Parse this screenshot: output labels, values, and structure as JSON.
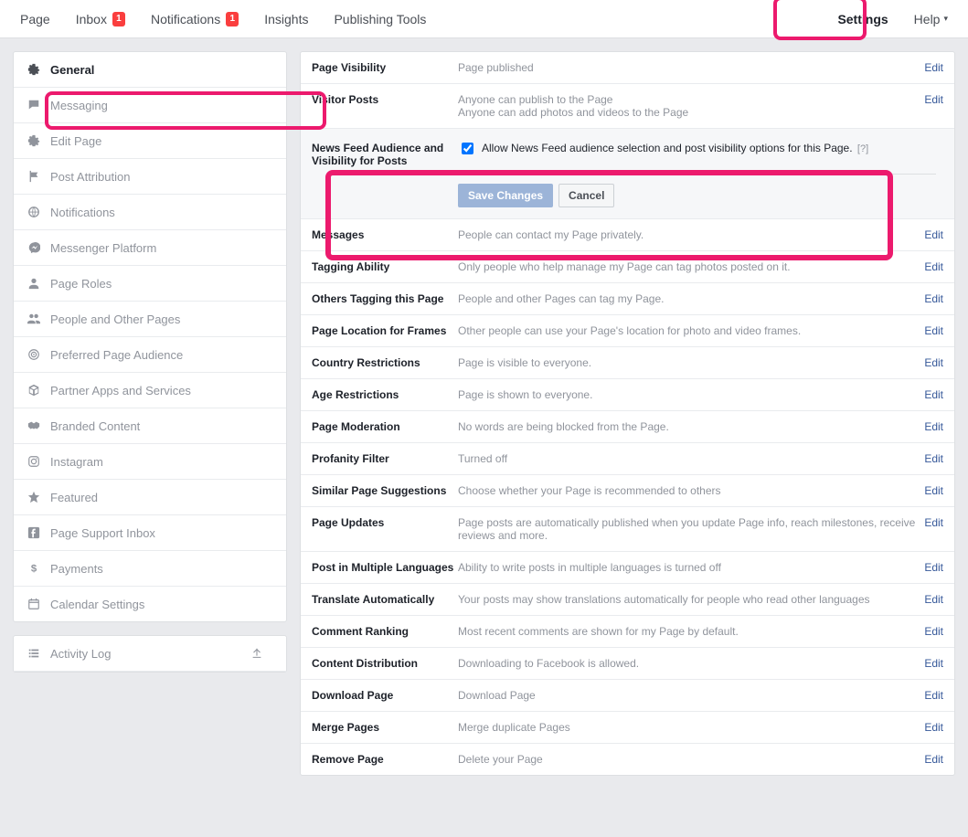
{
  "topnav": {
    "items": [
      {
        "label": "Page",
        "badge": null
      },
      {
        "label": "Inbox",
        "badge": "1"
      },
      {
        "label": "Notifications",
        "badge": "1"
      },
      {
        "label": "Insights",
        "badge": null
      },
      {
        "label": "Publishing Tools",
        "badge": null
      }
    ],
    "right": [
      {
        "label": "Settings",
        "active": true
      },
      {
        "label": "Help",
        "caret": true
      }
    ]
  },
  "sidebar": {
    "items": [
      {
        "icon": "gear",
        "label": "General",
        "active": true
      },
      {
        "icon": "chat",
        "label": "Messaging"
      },
      {
        "icon": "gear",
        "label": "Edit Page"
      },
      {
        "icon": "flag",
        "label": "Post Attribution"
      },
      {
        "icon": "globe",
        "label": "Notifications"
      },
      {
        "icon": "messenger",
        "label": "Messenger Platform"
      },
      {
        "icon": "person",
        "label": "Page Roles"
      },
      {
        "icon": "people",
        "label": "People and Other Pages"
      },
      {
        "icon": "target",
        "label": "Preferred Page Audience"
      },
      {
        "icon": "box",
        "label": "Partner Apps and Services"
      },
      {
        "icon": "handshake",
        "label": "Branded Content"
      },
      {
        "icon": "instagram",
        "label": "Instagram"
      },
      {
        "icon": "star",
        "label": "Featured"
      },
      {
        "icon": "fb",
        "label": "Page Support Inbox"
      },
      {
        "icon": "dollar",
        "label": "Payments"
      },
      {
        "icon": "calendar",
        "label": "Calendar Settings"
      }
    ]
  },
  "activity_log": {
    "label": "Activity Log",
    "icon": "list"
  },
  "settings": {
    "rows": [
      {
        "label": "Page Visibility",
        "value": "Page published",
        "edit": "Edit"
      },
      {
        "label": "Visitor Posts",
        "value": "Anyone can publish to the Page",
        "value2": "Anyone can add photos and videos to the Page",
        "edit": "Edit"
      },
      {
        "label": "News Feed Audience and Visibility for Posts",
        "expanded": true,
        "checkbox": true,
        "checkbox_label": "Allow News Feed audience selection and post visibility options for this Page.",
        "help": "[?]",
        "save": "Save Changes",
        "cancel": "Cancel"
      },
      {
        "label": "Messages",
        "value": "People can contact my Page privately.",
        "edit": "Edit"
      },
      {
        "label": "Tagging Ability",
        "value": "Only people who help manage my Page can tag photos posted on it.",
        "edit": "Edit"
      },
      {
        "label": "Others Tagging this Page",
        "value": "People and other Pages can tag my Page.",
        "edit": "Edit"
      },
      {
        "label": "Page Location for Frames",
        "value": "Other people can use your Page's location for photo and video frames.",
        "edit": "Edit"
      },
      {
        "label": "Country Restrictions",
        "value": "Page is visible to everyone.",
        "edit": "Edit"
      },
      {
        "label": "Age Restrictions",
        "value": "Page is shown to everyone.",
        "edit": "Edit"
      },
      {
        "label": "Page Moderation",
        "value": "No words are being blocked from the Page.",
        "edit": "Edit"
      },
      {
        "label": "Profanity Filter",
        "value": "Turned off",
        "edit": "Edit"
      },
      {
        "label": "Similar Page Suggestions",
        "value": "Choose whether your Page is recommended to others",
        "edit": "Edit"
      },
      {
        "label": "Page Updates",
        "value": "Page posts are automatically published when you update Page info, reach milestones, receive reviews and more.",
        "edit": "Edit"
      },
      {
        "label": "Post in Multiple Languages",
        "value": "Ability to write posts in multiple languages is turned off",
        "edit": "Edit"
      },
      {
        "label": "Translate Automatically",
        "value": "Your posts may show translations automatically for people who read other languages",
        "edit": "Edit"
      },
      {
        "label": "Comment Ranking",
        "value": "Most recent comments are shown for my Page by default.",
        "edit": "Edit"
      },
      {
        "label": "Content Distribution",
        "value": "Downloading to Facebook is allowed.",
        "edit": "Edit"
      },
      {
        "label": "Download Page",
        "value": "Download Page",
        "edit": "Edit"
      },
      {
        "label": "Merge Pages",
        "value": "Merge duplicate Pages",
        "edit": "Edit"
      },
      {
        "label": "Remove Page",
        "value": "Delete your Page",
        "edit": "Edit"
      }
    ]
  }
}
